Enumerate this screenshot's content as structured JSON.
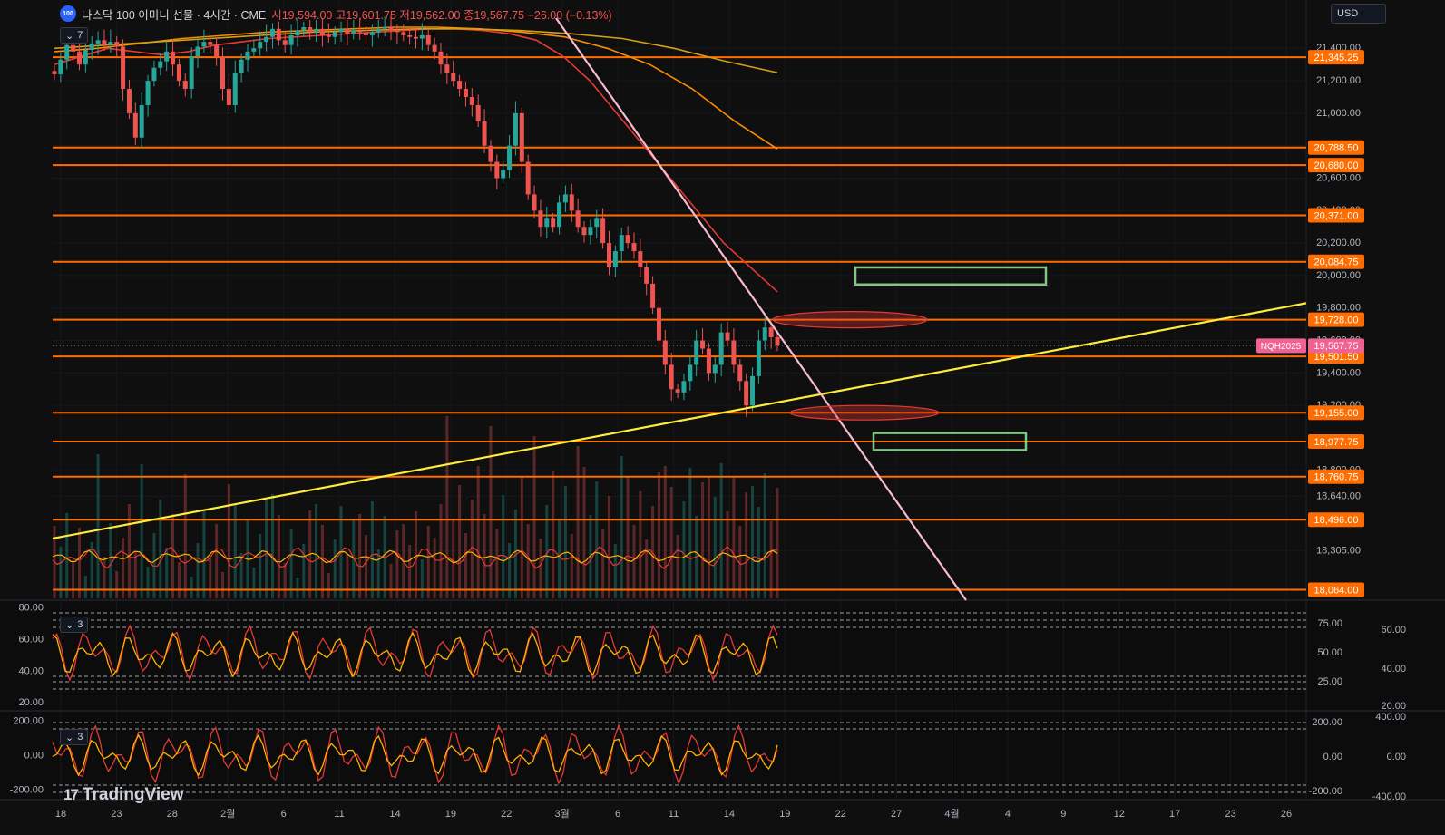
{
  "header": {
    "logo_text": "100",
    "symbol_title": "나스닥 100 이미니 선물 · 4시간 · CME",
    "ohlc": "시19,594.00 고19,601.75 저19,562.00 종19,567.75 −26.00 (−0.13%)"
  },
  "currency": "USD",
  "indicator_tags": {
    "main": "7",
    "rsi": "3",
    "cci": "3"
  },
  "brand": "TradingView",
  "colors": {
    "bull": "#26a69a",
    "bear": "#ef5350",
    "hline": "#ff6d00",
    "trend_up": "#ffeb3b",
    "trend_down": "#f8bbd0",
    "box": "#81c784"
  },
  "chart_data": [
    {
      "type": "line",
      "name": "price-4h",
      "x_ticks": [
        "18",
        "23",
        "28",
        "2월",
        "6",
        "11",
        "14",
        "19",
        "22",
        "3월",
        "6",
        "11",
        "14",
        "19",
        "22",
        "27",
        "4월",
        "4",
        "9",
        "12",
        "17",
        "23",
        "26"
      ],
      "y_ticks": [
        "21,400.00",
        "21,200.00",
        "21,000.00",
        "20,800.00",
        "20,600.00",
        "20,400.00",
        "20,200.00",
        "20,000.00",
        "19,800.00",
        "19,600.00",
        "19,400.00",
        "19,200.00",
        "18,800.00",
        "18,640.00",
        "18,305.00"
      ],
      "ylim": [
        18000,
        21530
      ],
      "horizontal_levels": [
        "21,345.25",
        "20,788.50",
        "20,680.00",
        "20,371.00",
        "20,084.75",
        "19,728.00",
        "19,501.50",
        "19,155.00",
        "18,977.75",
        "18,760.75",
        "18,496.00",
        "18,064.00"
      ],
      "last_price_label": "19,567.75",
      "symbol_label": "NQH2025",
      "close_series": [
        21240,
        21330,
        21420,
        21380,
        21300,
        21390,
        21430,
        21450,
        21420,
        21440,
        21410,
        21150,
        21000,
        20850,
        21050,
        21200,
        21280,
        21320,
        21380,
        21300,
        21200,
        21150,
        21350,
        21410,
        21440,
        21420,
        21350,
        21150,
        21050,
        21250,
        21330,
        21380,
        21400,
        21440,
        21470,
        21520,
        21450,
        21420,
        21480,
        21510,
        21530,
        21500,
        21520,
        21480,
        21470,
        21500,
        21520,
        21490,
        21510,
        21500,
        21480,
        21500,
        21520,
        21530,
        21510,
        21500,
        21480,
        21470,
        21460,
        21480,
        21420,
        21380,
        21300,
        21250,
        21200,
        21150,
        21100,
        21050,
        20950,
        20800,
        20700,
        20600,
        20650,
        20800,
        21000,
        20700,
        20500,
        20400,
        20300,
        20350,
        20300,
        20450,
        20500,
        20400,
        20300,
        20250,
        20300,
        20350,
        20200,
        20050,
        20150,
        20250,
        20200,
        20150,
        20050,
        19950,
        19800,
        19600,
        19450,
        19300,
        19280,
        19350,
        19450,
        19600,
        19550,
        19400,
        19450,
        19650,
        19600,
        19450,
        19350,
        19200,
        19380,
        19600,
        19680,
        19620,
        19570
      ],
      "ma_fast": [
        21300,
        21350,
        21400,
        21380,
        21360,
        21380,
        21420,
        21440,
        21460,
        21470,
        21480,
        21490,
        21500,
        21510,
        21520,
        21520,
        21510,
        21490,
        21450,
        21350,
        21200,
        21000,
        20800,
        20600,
        20400,
        20200,
        20050,
        19900
      ],
      "ma_mid": [
        21380,
        21400,
        21430,
        21460,
        21480,
        21500,
        21510,
        21520,
        21530,
        21530,
        21520,
        21500,
        21470,
        21400,
        21300,
        21150,
        20950,
        20780
      ],
      "ma_slow": [
        21400,
        21420,
        21440,
        21460,
        21480,
        21500,
        21510,
        21520,
        21520,
        21510,
        21490,
        21460,
        21400,
        21320,
        21250
      ],
      "trendline_up_label": "",
      "trendline_down_label": ""
    },
    {
      "type": "line",
      "name": "oscillator-1",
      "y_ticks_left": [
        "80.00",
        "60.00",
        "40.00",
        "20.00"
      ],
      "y_ticks_right_inner": [
        "75.00",
        "50.00",
        "25.00"
      ],
      "y_ticks_right_outer": [
        "60.00",
        "40.00",
        "20.00"
      ],
      "ylim": [
        15,
        85
      ]
    },
    {
      "type": "line",
      "name": "oscillator-2",
      "y_ticks_left": [
        "200.00",
        "0.00",
        "-200.00"
      ],
      "y_ticks_right_inner": [
        "200.00",
        "0.00",
        "-200.00"
      ],
      "y_ticks_right_outer": [
        "400.00",
        "0.00",
        "-400.00"
      ],
      "ylim": [
        -250,
        260
      ]
    }
  ]
}
